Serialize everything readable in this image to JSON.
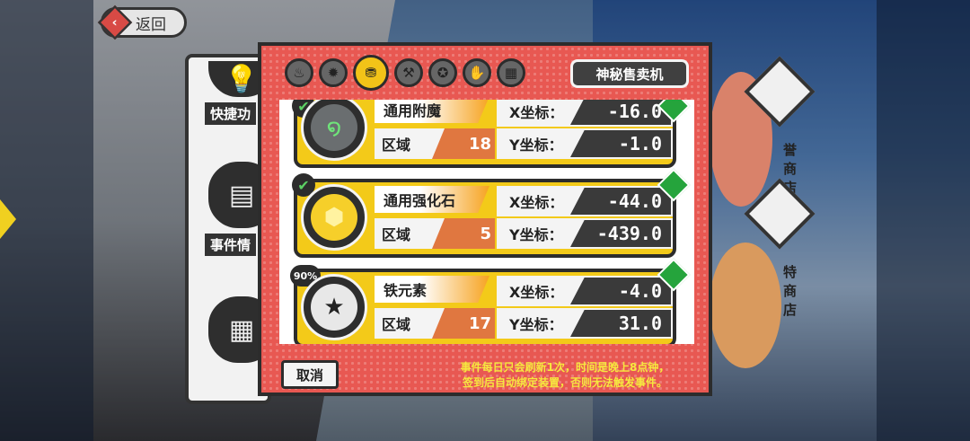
{
  "header": {
    "back_label": "返回"
  },
  "left_menu": {
    "items": [
      {
        "label": "快捷功"
      },
      {
        "label": "事件情"
      }
    ]
  },
  "right_menu": {
    "items": [
      {
        "label": "誉商店"
      },
      {
        "label": "特商店"
      }
    ]
  },
  "dialog": {
    "tabs": [
      {
        "icon": "fire-icon"
      },
      {
        "icon": "flame-icon"
      },
      {
        "icon": "coins-icon",
        "active": true
      },
      {
        "icon": "hammer-icon"
      },
      {
        "icon": "star-icon"
      },
      {
        "icon": "hand-icon"
      },
      {
        "icon": "grid-icon"
      }
    ],
    "shop_title": "神秘售卖机",
    "region_label": "区域",
    "x_label": "X坐标：",
    "y_label": "Y坐标：",
    "items": [
      {
        "name": "通用附魔",
        "region": "18",
        "x": "-16.0",
        "y": "-1.0",
        "icon": "enchant-rune-icon",
        "checked": true
      },
      {
        "name": "通用强化石",
        "region": "5",
        "x": "-44.0",
        "y": "-439.0",
        "icon": "gold-crystal-icon",
        "checked": true
      },
      {
        "name": "铁元素",
        "region": "17",
        "x": "-4.0",
        "y": "31.0",
        "icon": "iron-star-icon",
        "badge": "90%"
      }
    ],
    "cancel_label": "取消",
    "notice_line1": "事件每日只会刷新1次，时间是晚上8点钟，",
    "notice_line2": "签到后自动绑定装置，否则无法触发事件。"
  },
  "colors": {
    "dialog_red": "#e85852",
    "card_yellow": "#f3ca19",
    "accent_orange": "#e07740",
    "gem_green": "#25a43c",
    "notice_yellow": "#f6e83e"
  }
}
